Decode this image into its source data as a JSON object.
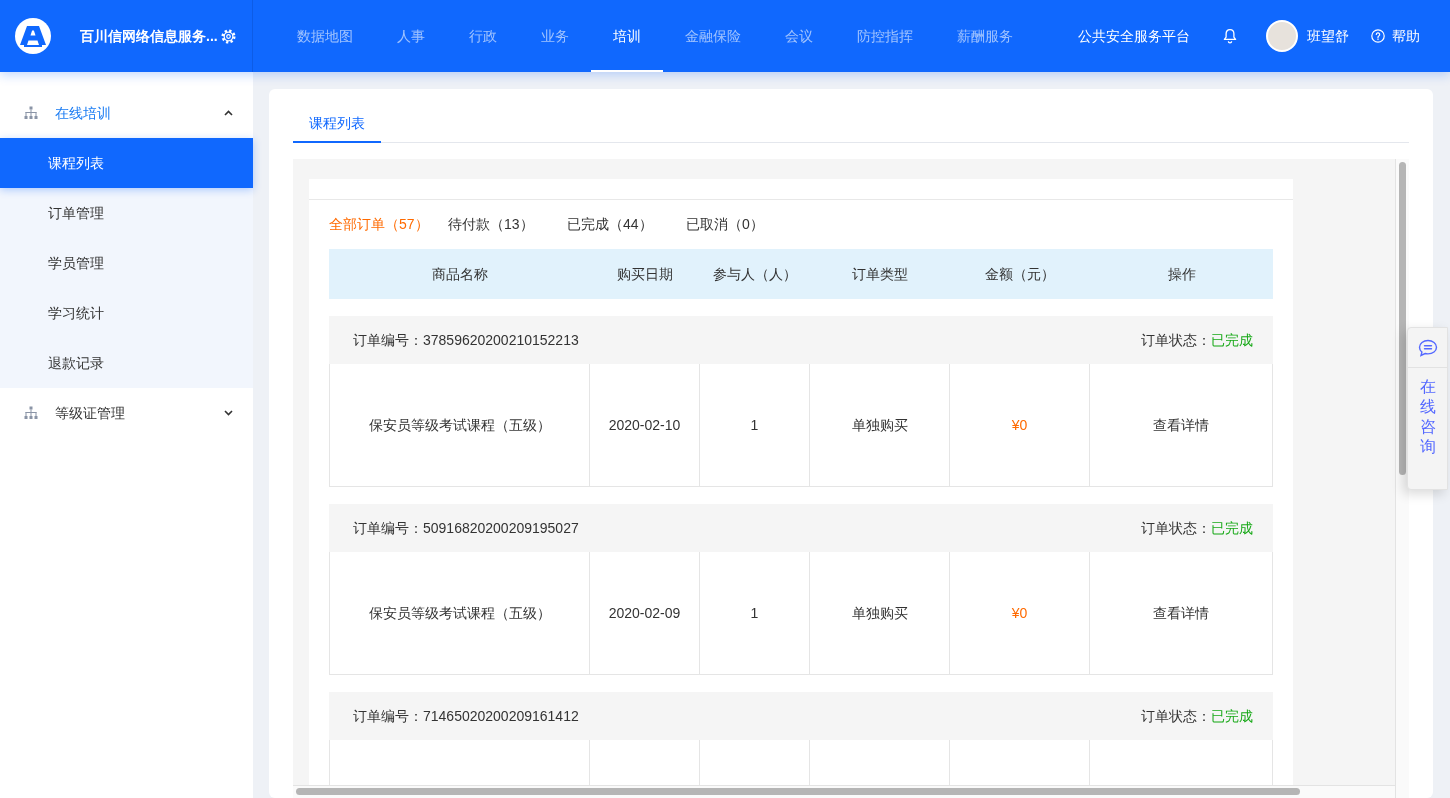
{
  "header": {
    "title": "百川信网络信息服务...",
    "nav": [
      {
        "label": "数据地图",
        "selected": false
      },
      {
        "label": "人事",
        "selected": false
      },
      {
        "label": "行政",
        "selected": false
      },
      {
        "label": "业务",
        "selected": false
      },
      {
        "label": "培训",
        "selected": true
      },
      {
        "label": "金融保险",
        "selected": false
      },
      {
        "label": "会议",
        "selected": false
      },
      {
        "label": "防控指挥",
        "selected": false
      },
      {
        "label": "薪酬服务",
        "selected": false
      }
    ],
    "platform": "公共安全服务平台",
    "user": "班望舒",
    "help": "帮助"
  },
  "sidebar": {
    "groups": [
      {
        "label": "在线培训",
        "expanded": true,
        "children": [
          {
            "label": "课程列表",
            "selected": true
          },
          {
            "label": "订单管理",
            "selected": false
          },
          {
            "label": "学员管理",
            "selected": false
          },
          {
            "label": "学习统计",
            "selected": false
          },
          {
            "label": "退款记录",
            "selected": false
          }
        ]
      },
      {
        "label": "等级证管理",
        "expanded": false
      }
    ]
  },
  "page_tabs": [
    {
      "label": "课程列表",
      "selected": true
    }
  ],
  "order_filters": [
    {
      "label": "全部订单（57）",
      "selected": true
    },
    {
      "label": "待付款（13）",
      "selected": false
    },
    {
      "label": "已完成（44）",
      "selected": false
    },
    {
      "label": "已取消（0）",
      "selected": false
    }
  ],
  "table": {
    "columns": [
      "商品名称",
      "购买日期",
      "参与人（人）",
      "订单类型",
      "金额（元）",
      "操作"
    ],
    "orders": [
      {
        "number": "订单编号：37859620200210152213",
        "status_label": "订单状态：",
        "status": "已完成",
        "row": {
          "product": "保安员等级考试课程（五级）",
          "date": "2020-02-10",
          "participants": "1",
          "type": "单独购买",
          "amount": "¥0",
          "action": "查看详情"
        }
      },
      {
        "number": "订单编号：50916820200209195027",
        "status_label": "订单状态：",
        "status": "已完成",
        "row": {
          "product": "保安员等级考试课程（五级）",
          "date": "2020-02-09",
          "participants": "1",
          "type": "单独购买",
          "amount": "¥0",
          "action": "查看详情"
        }
      },
      {
        "number": "订单编号：71465020200209161412",
        "status_label": "订单状态：",
        "status": "已完成"
      }
    ]
  },
  "chat": {
    "label": "在线咨询"
  }
}
